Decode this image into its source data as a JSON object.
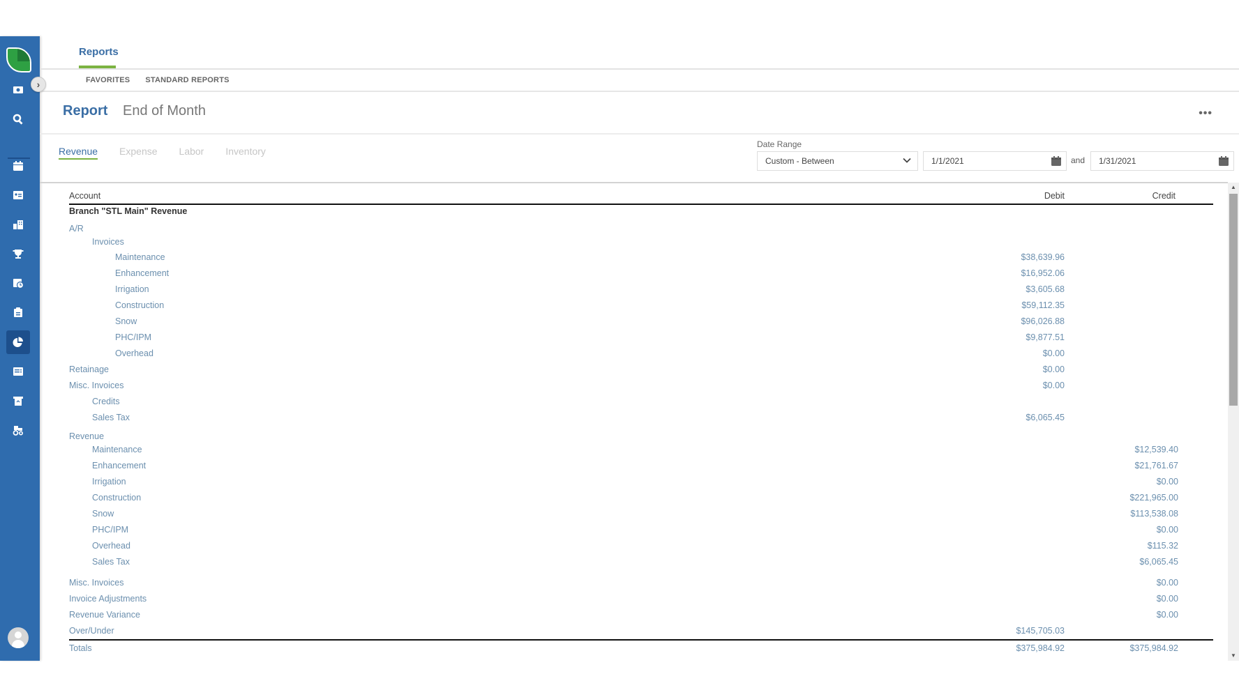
{
  "sidebar": {
    "icons": [
      "money-icon",
      "search-icon",
      "calendar-icon",
      "contact-card-icon",
      "buildings-icon",
      "trophy-icon",
      "schedule-icon",
      "clipboard-icon",
      "pie-chart-icon",
      "list-icon",
      "receipt-icon",
      "equipment-icon"
    ],
    "active": "pie-chart-icon"
  },
  "header": {
    "tab": "Reports",
    "subtabs": [
      "FAVORITES",
      "STANDARD REPORTS"
    ]
  },
  "report": {
    "label": "Report",
    "name": "End of Month",
    "more": "•••"
  },
  "report_tabs": [
    {
      "label": "Revenue",
      "active": true
    },
    {
      "label": "Expense",
      "active": false
    },
    {
      "label": "Labor",
      "active": false
    },
    {
      "label": "Inventory",
      "active": false
    }
  ],
  "filters": {
    "date_range_label": "Date Range",
    "date_range_value": "Custom - Between",
    "start_date": "1/1/2021",
    "and_label": "and",
    "end_date": "1/31/2021"
  },
  "table": {
    "columns": {
      "account": "Account",
      "debit": "Debit",
      "credit": "Credit"
    },
    "branch_title": "Branch \"STL Main\" Revenue",
    "rows": [
      {
        "account": "A/R",
        "level": 0,
        "debit": "",
        "credit": ""
      },
      {
        "account": "Invoices",
        "level": 1,
        "debit": "",
        "credit": ""
      },
      {
        "account": "Maintenance",
        "level": 2,
        "debit": "$38,639.96",
        "credit": ""
      },
      {
        "account": "Enhancement",
        "level": 2,
        "debit": "$16,952.06",
        "credit": ""
      },
      {
        "account": "Irrigation",
        "level": 2,
        "debit": "$3,605.68",
        "credit": ""
      },
      {
        "account": "Construction",
        "level": 2,
        "debit": "$59,112.35",
        "credit": ""
      },
      {
        "account": "Snow",
        "level": 2,
        "debit": "$96,026.88",
        "credit": ""
      },
      {
        "account": "PHC/IPM",
        "level": 2,
        "debit": "$9,877.51",
        "credit": ""
      },
      {
        "account": "Overhead",
        "level": 2,
        "debit": "$0.00",
        "credit": ""
      },
      {
        "account": "Retainage",
        "level": 0,
        "debit": "$0.00",
        "credit": ""
      },
      {
        "account": "Misc. Invoices",
        "level": 0,
        "debit": "$0.00",
        "credit": ""
      },
      {
        "account": "Credits",
        "level": 1,
        "debit": "",
        "credit": ""
      },
      {
        "account": "Sales Tax",
        "level": 1,
        "debit": "$6,065.45",
        "credit": ""
      },
      {
        "account": "Revenue",
        "level": 0,
        "debit": "",
        "credit": ""
      },
      {
        "account": "Maintenance",
        "level": 1,
        "debit": "",
        "credit": "$12,539.40"
      },
      {
        "account": "Enhancement",
        "level": 1,
        "debit": "",
        "credit": "$21,761.67"
      },
      {
        "account": "Irrigation",
        "level": 1,
        "debit": "",
        "credit": "$0.00"
      },
      {
        "account": "Construction",
        "level": 1,
        "debit": "",
        "credit": "$221,965.00"
      },
      {
        "account": "Snow",
        "level": 1,
        "debit": "",
        "credit": "$113,538.08"
      },
      {
        "account": "PHC/IPM",
        "level": 1,
        "debit": "",
        "credit": "$0.00"
      },
      {
        "account": "Overhead",
        "level": 1,
        "debit": "",
        "credit": "$115.32"
      },
      {
        "account": "Sales Tax",
        "level": 1,
        "debit": "",
        "credit": "$6,065.45"
      },
      {
        "account": "Misc. Invoices",
        "level": 0,
        "debit": "",
        "credit": "$0.00"
      },
      {
        "account": "Invoice Adjustments",
        "level": 0,
        "debit": "",
        "credit": "$0.00"
      },
      {
        "account": "Revenue Variance",
        "level": 0,
        "debit": "",
        "credit": "$0.00"
      },
      {
        "account": "Over/Under",
        "level": 0,
        "debit": "$145,705.03",
        "credit": ""
      }
    ],
    "totals": {
      "account": "Totals",
      "debit": "$375,984.92",
      "credit": "$375,984.92"
    }
  },
  "scrollbar": {
    "up": "▲",
    "down": "▼"
  }
}
